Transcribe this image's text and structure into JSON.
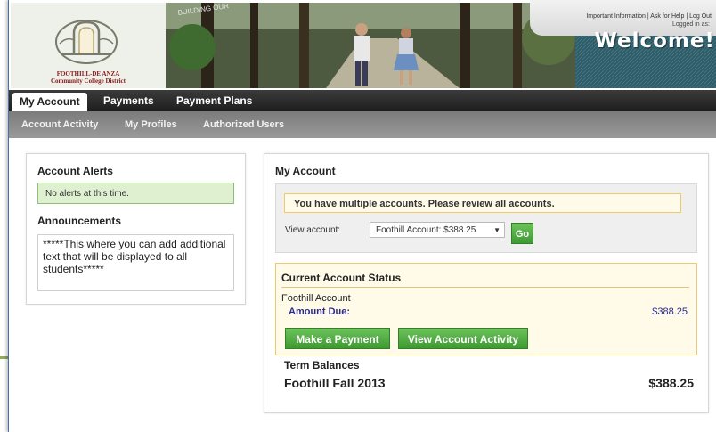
{
  "header": {
    "logo_line1": "FOOTHILL-DE ANZA",
    "logo_line2": "Community College District",
    "banner_text": "BUILDING OUR",
    "top_links": [
      "Important Information",
      "Ask for Help",
      "Log Out"
    ],
    "logged_in": "Logged in as:",
    "welcome": "Welcome!"
  },
  "nav": {
    "tabs": [
      {
        "label": "My Account",
        "active": true
      },
      {
        "label": "Payments",
        "active": false
      },
      {
        "label": "Payment Plans",
        "active": false
      }
    ],
    "subtabs": [
      "Account Activity",
      "My Profiles",
      "Authorized Users"
    ]
  },
  "alerts": {
    "title": "Account Alerts",
    "message": "No alerts at this time."
  },
  "announcements": {
    "title": "Announcements",
    "text": "*****This where you can add additional text that will be displayed to all students*****"
  },
  "my_account": {
    "title": "My Account",
    "multi_msg": "You have multiple accounts. Please review all accounts.",
    "view_label": "View account:",
    "selected_account": "Foothill Account: $388.25",
    "go_label": "Go",
    "status_title": "Current Account Status",
    "account_name": "Foothill Account",
    "amount_due_label": "Amount Due:",
    "amount_due_value": "$388.25",
    "make_payment_label": "Make a Payment",
    "view_activity_label": "View Account Activity",
    "term_title": "Term Balances",
    "term_name": "Foothill Fall 2013",
    "term_amount": "$388.25"
  },
  "colors": {
    "nav_dark": "#1e1e1e",
    "subnav_gray": "#8a8a8a",
    "button_green": "#3e9a32",
    "alert_green": "#dff0d0",
    "status_yellow": "#fffbe8",
    "link_blue": "#2a2a8f",
    "welcome_teal": "#2f5c66"
  }
}
